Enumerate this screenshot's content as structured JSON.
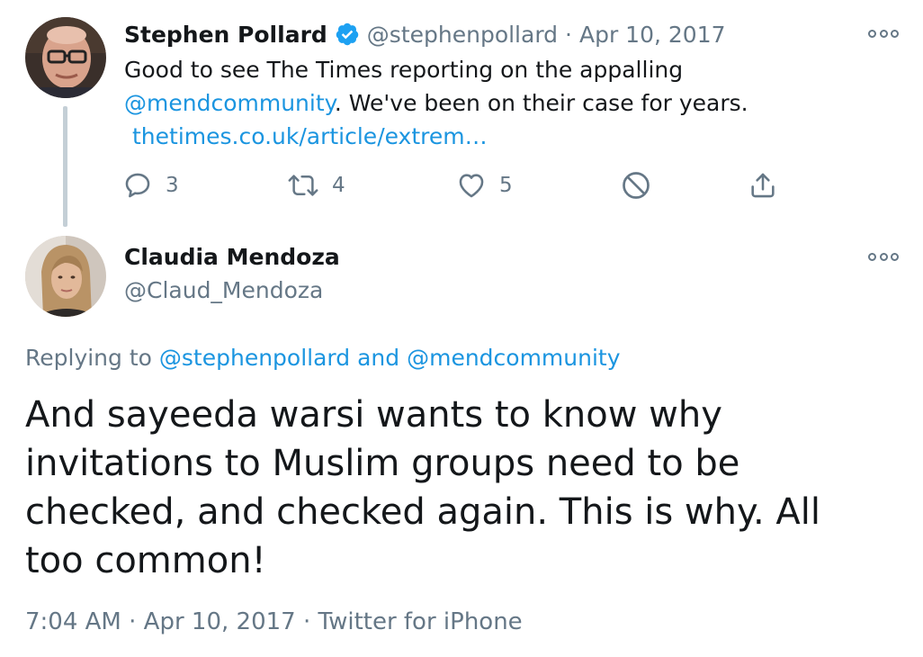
{
  "tweet1": {
    "author_name": "Stephen Pollard",
    "handle": "@stephenpollard",
    "separator": "·",
    "date": "Apr 10, 2017",
    "text_line1": "Good to see The Times reporting on the appalling",
    "mention": "@mendcommunity",
    "text_line2_rest": ". We've been on their case for years.",
    "link_text": "thetimes.co.uk/article/extrem…",
    "actions": {
      "reply_count": "3",
      "retweet_count": "4",
      "like_count": "5"
    },
    "icons": [
      "verified-badge-icon",
      "reply-icon",
      "retweet-icon",
      "like-icon",
      "block-icon",
      "share-icon",
      "more-icon"
    ]
  },
  "tweet2": {
    "author_name": "Claudia Mendoza",
    "handle": "@Claud_Mendoza",
    "replying_prefix": "Replying to",
    "replying_user1": "@stephenpollard",
    "replying_and": "and",
    "replying_user2": "@mendcommunity",
    "text": "And sayeeda warsi wants to know why invitations to Muslim groups need to be checked, and checked again. This is why. All too common!",
    "time": "7:04 AM",
    "separator": "·",
    "date": "Apr 10, 2017",
    "client": "Twitter for iPhone"
  },
  "colors": {
    "text": "#14171a",
    "muted": "#657786",
    "link": "#1b95e0",
    "verified": "#1da1f2",
    "thread_line": "#c4cfd6"
  }
}
